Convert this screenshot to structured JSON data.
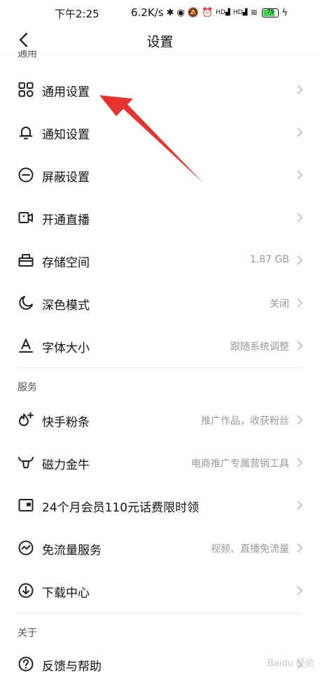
{
  "status_bar": {
    "time": "下午2:25",
    "network_speed": "6.2K/s",
    "signal_1": "HD",
    "signal_2": "HD",
    "battery": "75"
  },
  "header": {
    "title": "设置"
  },
  "sections": {
    "general": "通用",
    "services": "服务",
    "about": "关于"
  },
  "rows": {
    "general_settings": {
      "label": "通用设置",
      "value": ""
    },
    "notification_settings": {
      "label": "通知设置",
      "value": ""
    },
    "block_settings": {
      "label": "屏蔽设置",
      "value": ""
    },
    "live_stream": {
      "label": "开通直播",
      "value": ""
    },
    "storage": {
      "label": "存储空间",
      "value": "1.87 GB"
    },
    "dark_mode": {
      "label": "深色模式",
      "value": "关闭"
    },
    "font_size": {
      "label": "字体大小",
      "value": "跟随系统调整"
    },
    "kuaishou_boost": {
      "label": "快手粉条",
      "value": "推广作品，收获粉丝"
    },
    "magnetic_bull": {
      "label": "磁力金牛",
      "value": "电商推广专属营销工具"
    },
    "membership": {
      "label": "24个月会员110元话费限时领",
      "value": ""
    },
    "free_data": {
      "label": "免流量服务",
      "value": "视频、直播免流量"
    },
    "download_center": {
      "label": "下载中心",
      "value": ""
    },
    "feedback": {
      "label": "反馈与帮助",
      "value": ""
    }
  },
  "watermark": "Baidu 经验"
}
